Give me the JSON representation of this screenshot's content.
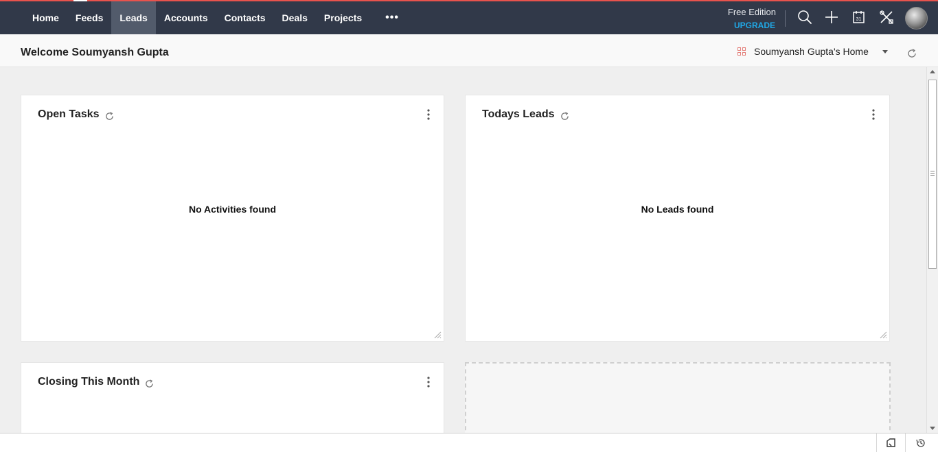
{
  "nav": {
    "items": [
      {
        "label": "Home"
      },
      {
        "label": "Feeds"
      },
      {
        "label": "Leads"
      },
      {
        "label": "Accounts"
      },
      {
        "label": "Contacts"
      },
      {
        "label": "Deals"
      },
      {
        "label": "Projects"
      }
    ],
    "active": "Leads",
    "more_label": "•••"
  },
  "edition": {
    "text": "Free Edition",
    "upgrade": "UPGRADE"
  },
  "toolbar_icons": [
    "search-icon",
    "plus-icon",
    "calendar-icon",
    "tools-icon"
  ],
  "calendar_day": "31",
  "header": {
    "welcome": "Welcome Soumyansh Gupta",
    "home_select": "Soumyansh Gupta's Home"
  },
  "cards": [
    {
      "title": "Open Tasks",
      "empty": "No Activities found"
    },
    {
      "title": "Todays Leads",
      "empty": "No Leads found"
    },
    {
      "title": "Closing This Month",
      "empty": ""
    }
  ],
  "colors": {
    "topbar": "#313949",
    "accent_top": "#e8534d",
    "upgrade": "#20a8e6",
    "active_tab": "#525b6b"
  }
}
